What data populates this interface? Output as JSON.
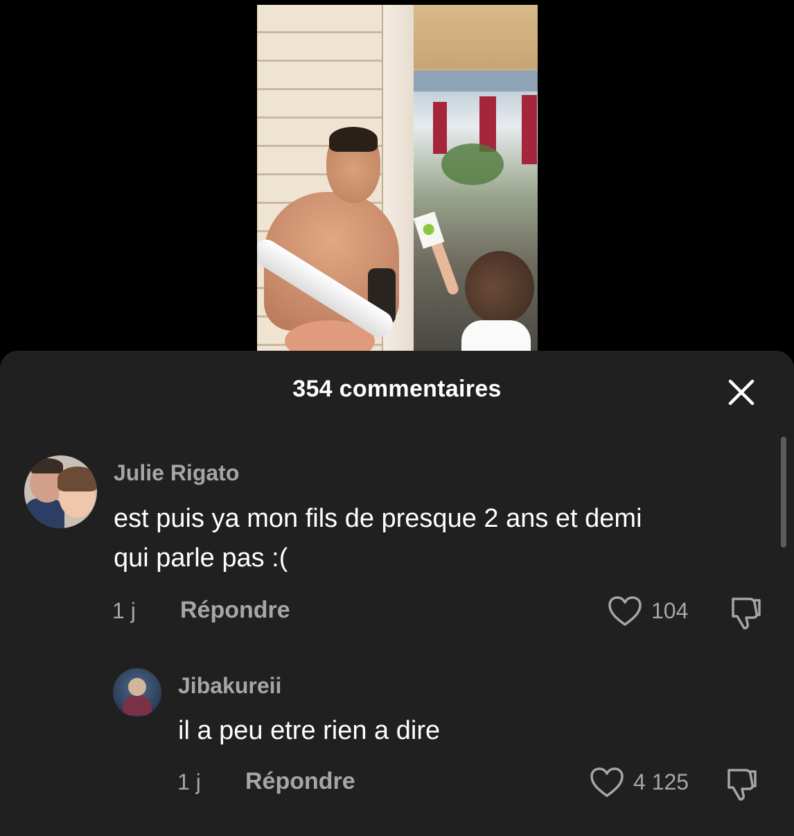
{
  "sheet": {
    "title": "354 commentaires"
  },
  "comments": [
    {
      "username": "Julie Rigato",
      "text_line1": "est puis ya mon fils de presque 2 ans et demi",
      "text_line2": "qui parle pas :(",
      "time": "1 j",
      "reply_label": "Répondre",
      "likes": "104"
    },
    {
      "username": "Jibakureii",
      "text_line1": "il a peu etre rien a dire",
      "time": "1 j",
      "reply_label": "Répondre",
      "likes": "4 125"
    }
  ],
  "icons": {
    "close": "close-icon",
    "like": "heart-outline-icon",
    "dislike": "thumbs-down-icon"
  },
  "colors": {
    "sheet_bg": "#202020",
    "text_primary": "#ffffff",
    "text_secondary": "#a6a6a6"
  }
}
